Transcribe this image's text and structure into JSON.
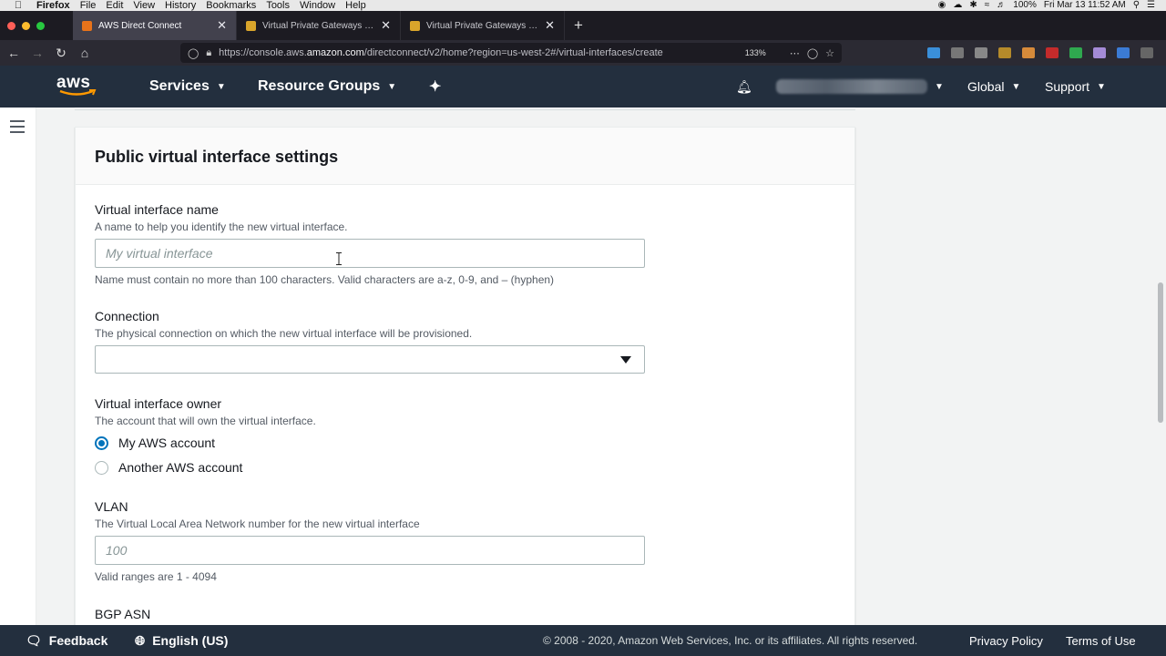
{
  "macos_menubar": {
    "app_name": "Firefox",
    "menus": [
      "File",
      "Edit",
      "View",
      "History",
      "Bookmarks",
      "Tools",
      "Window",
      "Help"
    ],
    "battery": "100%",
    "datetime": "Fri Mar 13  11:52 AM"
  },
  "browser": {
    "tabs": [
      {
        "title": "AWS Direct Connect",
        "active": true,
        "favicon_color": "#e8731a"
      },
      {
        "title": "Virtual Private Gateways | VPC",
        "active": false,
        "favicon_color": "#d9a52b"
      },
      {
        "title": "Virtual Private Gateways | VPC",
        "active": false,
        "favicon_color": "#d9a52b"
      }
    ],
    "url_prefix": "https://console.aws.",
    "url_domain": "amazon.com",
    "url_suffix": "/directconnect/v2/home?region=us-west-2#/virtual-interfaces/create",
    "zoom": "133%"
  },
  "aws_header": {
    "logo": "aws",
    "services": "Services",
    "resource_groups": "Resource Groups",
    "region": "Global",
    "support": "Support"
  },
  "card": {
    "title": "Public virtual interface settings",
    "vif_name": {
      "label": "Virtual interface name",
      "description": "A name to help you identify the new virtual interface.",
      "placeholder": "My virtual interface",
      "constraint": "Name must contain no more than 100 characters. Valid characters are a-z, 0-9, and – (hyphen)"
    },
    "connection": {
      "label": "Connection",
      "description": "The physical connection on which the new virtual interface will be provisioned.",
      "value": ""
    },
    "owner": {
      "label": "Virtual interface owner",
      "description": "The account that will own the virtual interface.",
      "options": [
        {
          "label": "My AWS account",
          "checked": true
        },
        {
          "label": "Another AWS account",
          "checked": false
        }
      ]
    },
    "vlan": {
      "label": "VLAN",
      "description": "The Virtual Local Area Network number for the new virtual interface",
      "placeholder": "100",
      "constraint": "Valid ranges are 1 - 4094"
    },
    "bgp_asn": {
      "label": "BGP ASN"
    }
  },
  "footer": {
    "feedback": "Feedback",
    "language": "English (US)",
    "copyright": "© 2008 - 2020, Amazon Web Services, Inc. or its affiliates. All rights reserved.",
    "privacy": "Privacy Policy",
    "terms": "Terms of Use"
  }
}
